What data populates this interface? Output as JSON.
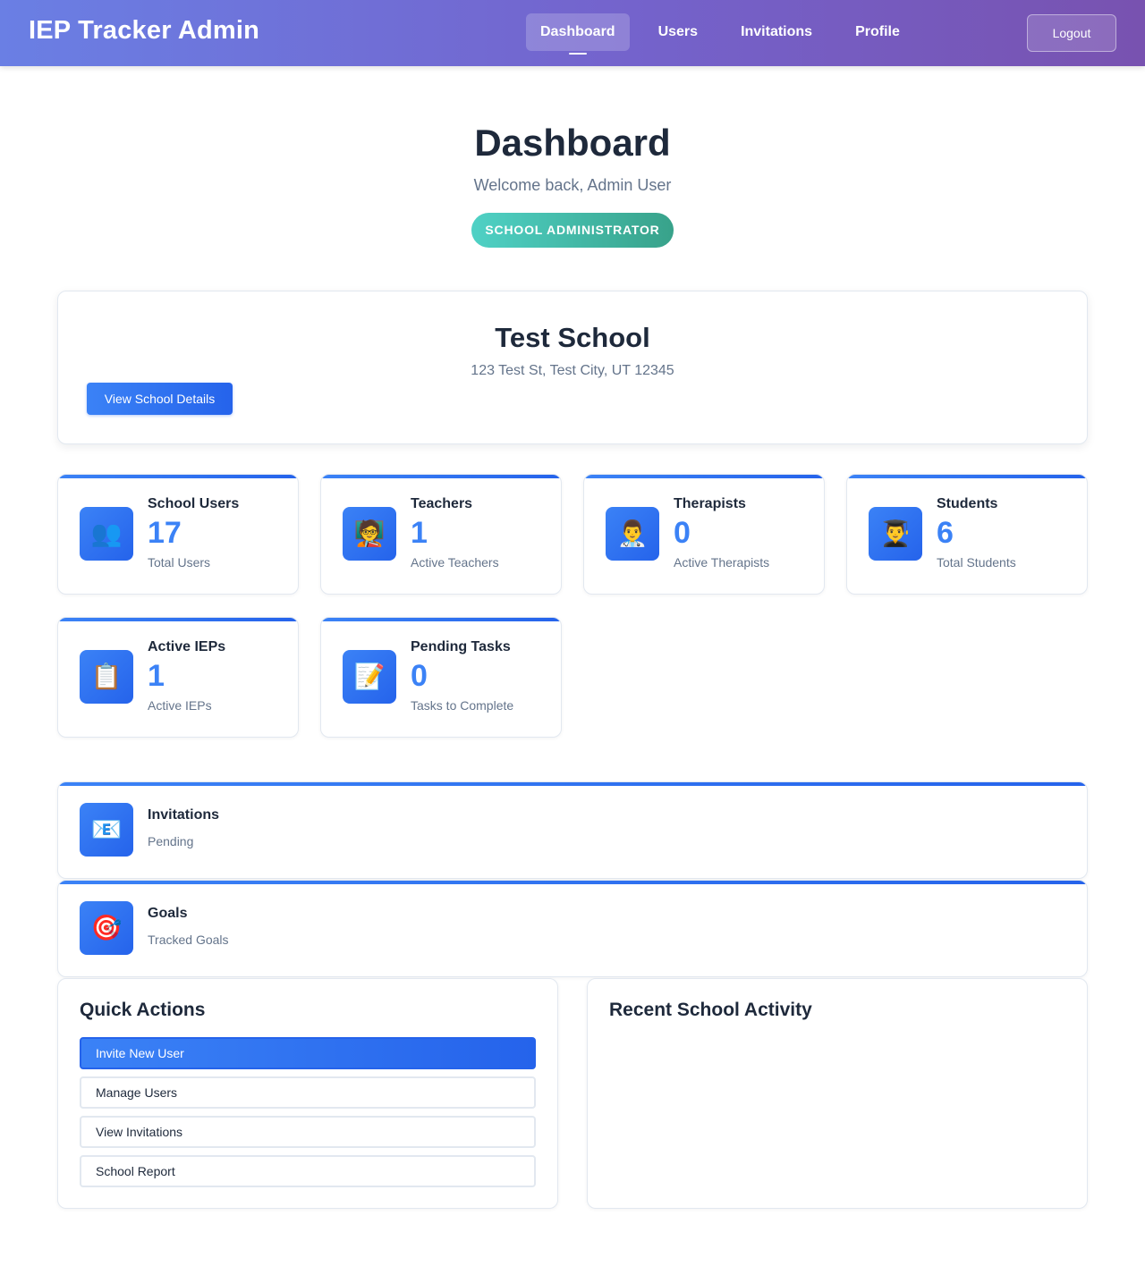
{
  "header": {
    "brand": "IEP Tracker Admin",
    "nav": [
      {
        "label": "Dashboard",
        "active": true
      },
      {
        "label": "Users",
        "active": false
      },
      {
        "label": "Invitations",
        "active": false
      },
      {
        "label": "Profile",
        "active": false
      }
    ],
    "logout_label": "Logout",
    "gradient_colors": [
      "#6a7fe4",
      "#7852b0"
    ]
  },
  "hero": {
    "title": "Dashboard",
    "welcome": "Welcome back, Admin User",
    "role_badge": "SCHOOL ADMINISTRATOR"
  },
  "school": {
    "name": "Test School",
    "address": "123 Test St, Test City, UT 12345",
    "details_button": "View School Details"
  },
  "stats": [
    {
      "label": "School Users",
      "value": "17",
      "sub": "Total Users",
      "icon": "users-icon",
      "glyph": "👥"
    },
    {
      "label": "Teachers",
      "value": "1",
      "sub": "Active Teachers",
      "icon": "teacher-icon",
      "glyph": "🧑‍🏫"
    },
    {
      "label": "Therapists",
      "value": "0",
      "sub": "Active Therapists",
      "icon": "health-worker-icon",
      "glyph": "👨‍⚕️"
    },
    {
      "label": "Students",
      "value": "6",
      "sub": "Total Students",
      "icon": "student-icon",
      "glyph": "👨‍🎓"
    },
    {
      "label": "Active IEPs",
      "value": "1",
      "sub": "Active IEPs",
      "icon": "clipboard-icon",
      "glyph": "📋"
    },
    {
      "label": "Pending Tasks",
      "value": "0",
      "sub": "Tasks to Complete",
      "icon": "memo-icon",
      "glyph": "📝"
    }
  ],
  "wide_cards": [
    {
      "label": "Invitations",
      "sub": "Pending",
      "icon": "envelope-icon",
      "glyph": "📧"
    },
    {
      "label": "Goals",
      "sub": "Tracked Goals",
      "icon": "target-icon",
      "glyph": "🎯"
    }
  ],
  "quick_actions": {
    "title": "Quick Actions",
    "buttons": [
      "Invite New User",
      "Manage Users",
      "View Invitations",
      "School Report"
    ]
  },
  "recent_activity": {
    "title": "Recent School Activity"
  },
  "colors": {
    "accent": "#3b82f6",
    "accent_dark": "#2563eb",
    "badge_teal": "#4fd1c5",
    "text_dark": "#1e293b",
    "text_muted": "#64748b",
    "border": "#e2e8f0"
  }
}
